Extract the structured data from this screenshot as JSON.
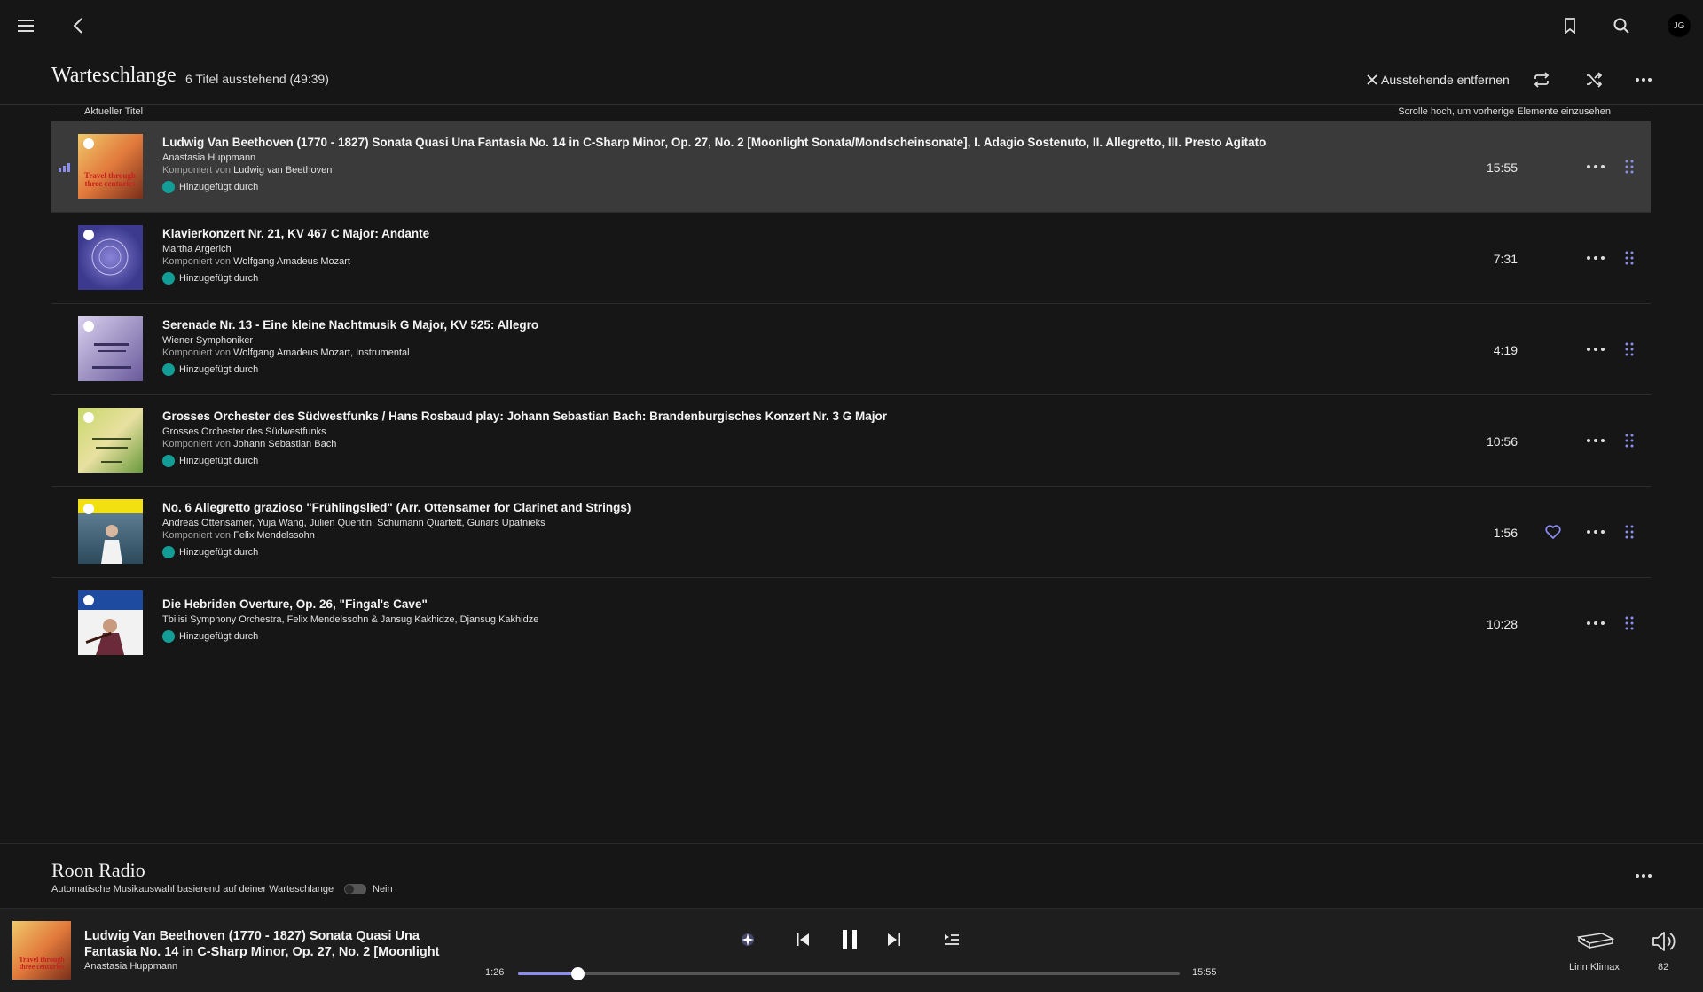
{
  "topbar": {
    "avatar_initials": "JG"
  },
  "queue": {
    "title": "Warteschlange",
    "subtitle": "6 Titel ausstehend (49:39)",
    "clear_label": "Ausstehende entfernen",
    "current_label": "Aktueller Titel",
    "scroll_hint": "Scrolle hoch, um vorherige Elemente einzusehen",
    "composer_prefix": "Komponiert von",
    "added_by_label": "Hinzugefügt durch",
    "tracks": [
      {
        "title": "Ludwig Van Beethoven (1770 - 1827) Sonata Quasi Una Fantasia No. 14 in C-Sharp Minor, Op. 27, No. 2 [Moonlight Sonata/Mondscheinsonate], I. Adagio Sostenuto, II. Allegretto, III. Presto Agitato",
        "artist": "Anastasia Huppmann",
        "composer": "Ludwig van Beethoven",
        "duration": "15:55",
        "current": true,
        "favorite": false
      },
      {
        "title": "Klavierkonzert Nr. 21, KV 467 C Major: Andante",
        "artist": "Martha Argerich",
        "composer": "Wolfgang Amadeus Mozart",
        "duration": "7:31",
        "current": false,
        "favorite": false
      },
      {
        "title": "Serenade Nr. 13 - Eine kleine Nachtmusik G Major, KV 525: Allegro",
        "artist": "Wiener Symphoniker",
        "composer": "Wolfgang Amadeus Mozart, Instrumental",
        "duration": "4:19",
        "current": false,
        "favorite": false
      },
      {
        "title": "Grosses Orchester des Südwestfunks / Hans Rosbaud play: Johann Sebastian Bach: Brandenburgisches Konzert Nr. 3 G Major",
        "artist": "Grosses Orchester des Südwestfunks",
        "composer": "Johann Sebastian Bach",
        "duration": "10:56",
        "current": false,
        "favorite": false
      },
      {
        "title": "No. 6 Allegretto grazioso \"Frühlingslied\" (Arr. Ottensamer for Clarinet and Strings)",
        "artist": "Andreas Ottensamer, Yuja Wang, Julien Quentin, Schumann Quartett, Gunars Upatnieks",
        "composer": "Felix Mendelssohn",
        "duration": "1:56",
        "current": false,
        "favorite": true
      },
      {
        "title": "Die Hebriden Overture, Op. 26, \"Fingal's Cave\"",
        "artist": "Tbilisi Symphony Orchestra, Felix Mendelssohn & Jansug Kakhidze, Djansug Kakhidze",
        "composer": "",
        "duration": "10:28",
        "current": false,
        "favorite": false
      }
    ]
  },
  "radio": {
    "title": "Roon Radio",
    "subtitle": "Automatische Musikauswahl basierend auf deiner Warteschlange",
    "toggle_label": "Nein",
    "enabled": false
  },
  "player": {
    "title": "Ludwig Van Beethoven (1770 - 1827) Sonata Quasi Una Fantasia No. 14 in C-Sharp Minor, Op. 27, No. 2 [Moonlight",
    "artist": "Anastasia Huppmann",
    "elapsed": "1:26",
    "total": "15:55",
    "progress_fraction": 0.09,
    "zone_name": "Linn Klimax",
    "volume": "82"
  },
  "colors": {
    "accent": "#8a8cf0",
    "teal": "#139d97",
    "background": "#161616",
    "current_row": "#3a3a3a"
  }
}
